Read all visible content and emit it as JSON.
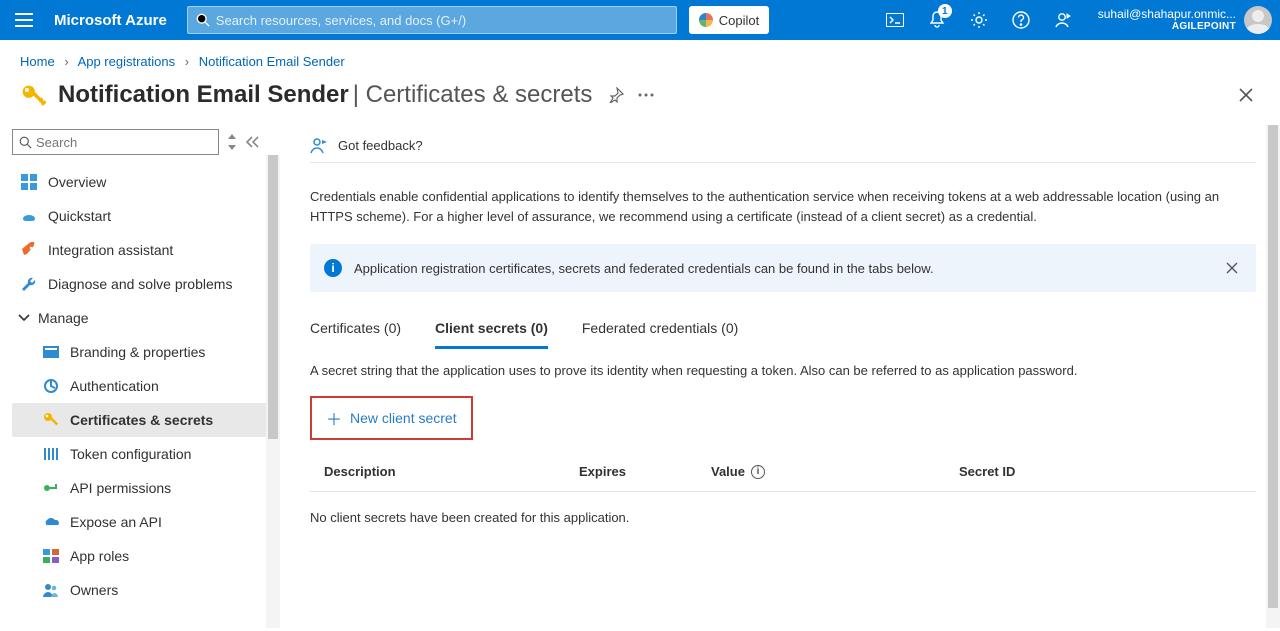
{
  "header": {
    "brand": "Microsoft Azure",
    "search_placeholder": "Search resources, services, and docs (G+/)",
    "copilot_label": "Copilot",
    "notification_count": "1",
    "account_email": "suhail@shahapur.onmic...",
    "account_tenant": "AGILEPOINT"
  },
  "breadcrumb": {
    "items": [
      "Home",
      "App registrations",
      "Notification Email Sender"
    ]
  },
  "page": {
    "title": "Notification Email Sender",
    "subtitle": "| Certificates & secrets"
  },
  "sidebar": {
    "search_placeholder": "Search",
    "items": [
      {
        "icon": "overview",
        "label": "Overview"
      },
      {
        "icon": "quickstart",
        "label": "Quickstart"
      },
      {
        "icon": "rocket",
        "label": "Integration assistant"
      },
      {
        "icon": "wrench",
        "label": "Diagnose and solve problems"
      }
    ],
    "manage_label": "Manage",
    "manage_items": [
      {
        "icon": "branding",
        "label": "Branding & properties"
      },
      {
        "icon": "auth",
        "label": "Authentication"
      },
      {
        "icon": "key",
        "label": "Certificates & secrets",
        "active": true
      },
      {
        "icon": "token",
        "label": "Token configuration"
      },
      {
        "icon": "api-perm",
        "label": "API permissions"
      },
      {
        "icon": "expose",
        "label": "Expose an API"
      },
      {
        "icon": "roles",
        "label": "App roles"
      },
      {
        "icon": "owners",
        "label": "Owners"
      }
    ]
  },
  "main": {
    "feedback_label": "Got feedback?",
    "description": "Credentials enable confidential applications to identify themselves to the authentication service when receiving tokens at a web addressable location (using an HTTPS scheme). For a higher level of assurance, we recommend using a certificate (instead of a client secret) as a credential.",
    "info_banner": "Application registration certificates, secrets and federated credentials can be found in the tabs below.",
    "tabs": [
      {
        "label": "Certificates (0)"
      },
      {
        "label": "Client secrets (0)",
        "active": true
      },
      {
        "label": "Federated credentials (0)"
      }
    ],
    "tab_desc": "A secret string that the application uses to prove its identity when requesting a token. Also can be referred to as application password.",
    "new_secret_label": "New client secret",
    "table": {
      "columns": [
        "Description",
        "Expires",
        "Value",
        "Secret ID"
      ],
      "empty": "No client secrets have been created for this application."
    }
  }
}
